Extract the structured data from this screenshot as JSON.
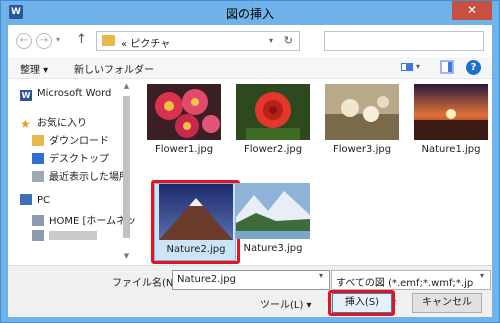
{
  "window": {
    "title": "図の挿入",
    "app_icon": "W",
    "close": "✕"
  },
  "nav": {
    "back": "←",
    "forward": "→",
    "up": "↑",
    "address": "« ピクチャ"
  },
  "toolbar": {
    "organize": "整理 ▾",
    "new_folder": "新しいフォルダー"
  },
  "sidebar": {
    "items": [
      {
        "label": "Microsoft Word",
        "icon": "word-icon"
      },
      {
        "label": "お気に入り",
        "icon": "star-icon"
      },
      {
        "label": "ダウンロード",
        "icon": "download-folder-icon"
      },
      {
        "label": "デスクトップ",
        "icon": "desktop-icon"
      },
      {
        "label": "最近表示した場所",
        "icon": "recent-places-icon"
      },
      {
        "label": "PC",
        "icon": "pc-icon"
      },
      {
        "label": "HOME [ホームネッ",
        "icon": "network-drive-icon"
      },
      {
        "label": "",
        "icon": "network-drive-icon"
      }
    ]
  },
  "files": [
    {
      "name": "Flower1.jpg"
    },
    {
      "name": "Flower2.jpg"
    },
    {
      "name": "Flower3.jpg"
    },
    {
      "name": "Nature1.jpg"
    },
    {
      "name": "Nature2.jpg",
      "selected": true
    },
    {
      "name": "Nature3.jpg"
    }
  ],
  "footer": {
    "filename_label": "ファイル名(N):",
    "filename_value": "Nature2.jpg",
    "filetype": "すべての図 (*.emf;*.wmf;*.jp",
    "tools": "ツール(L)  ▾",
    "insert": "挿入(S)",
    "cancel": "キャンセル"
  },
  "colors": {
    "highlight": "#e5141c",
    "titlebar": "#6fb3ea",
    "selection": "#cce4f7"
  }
}
